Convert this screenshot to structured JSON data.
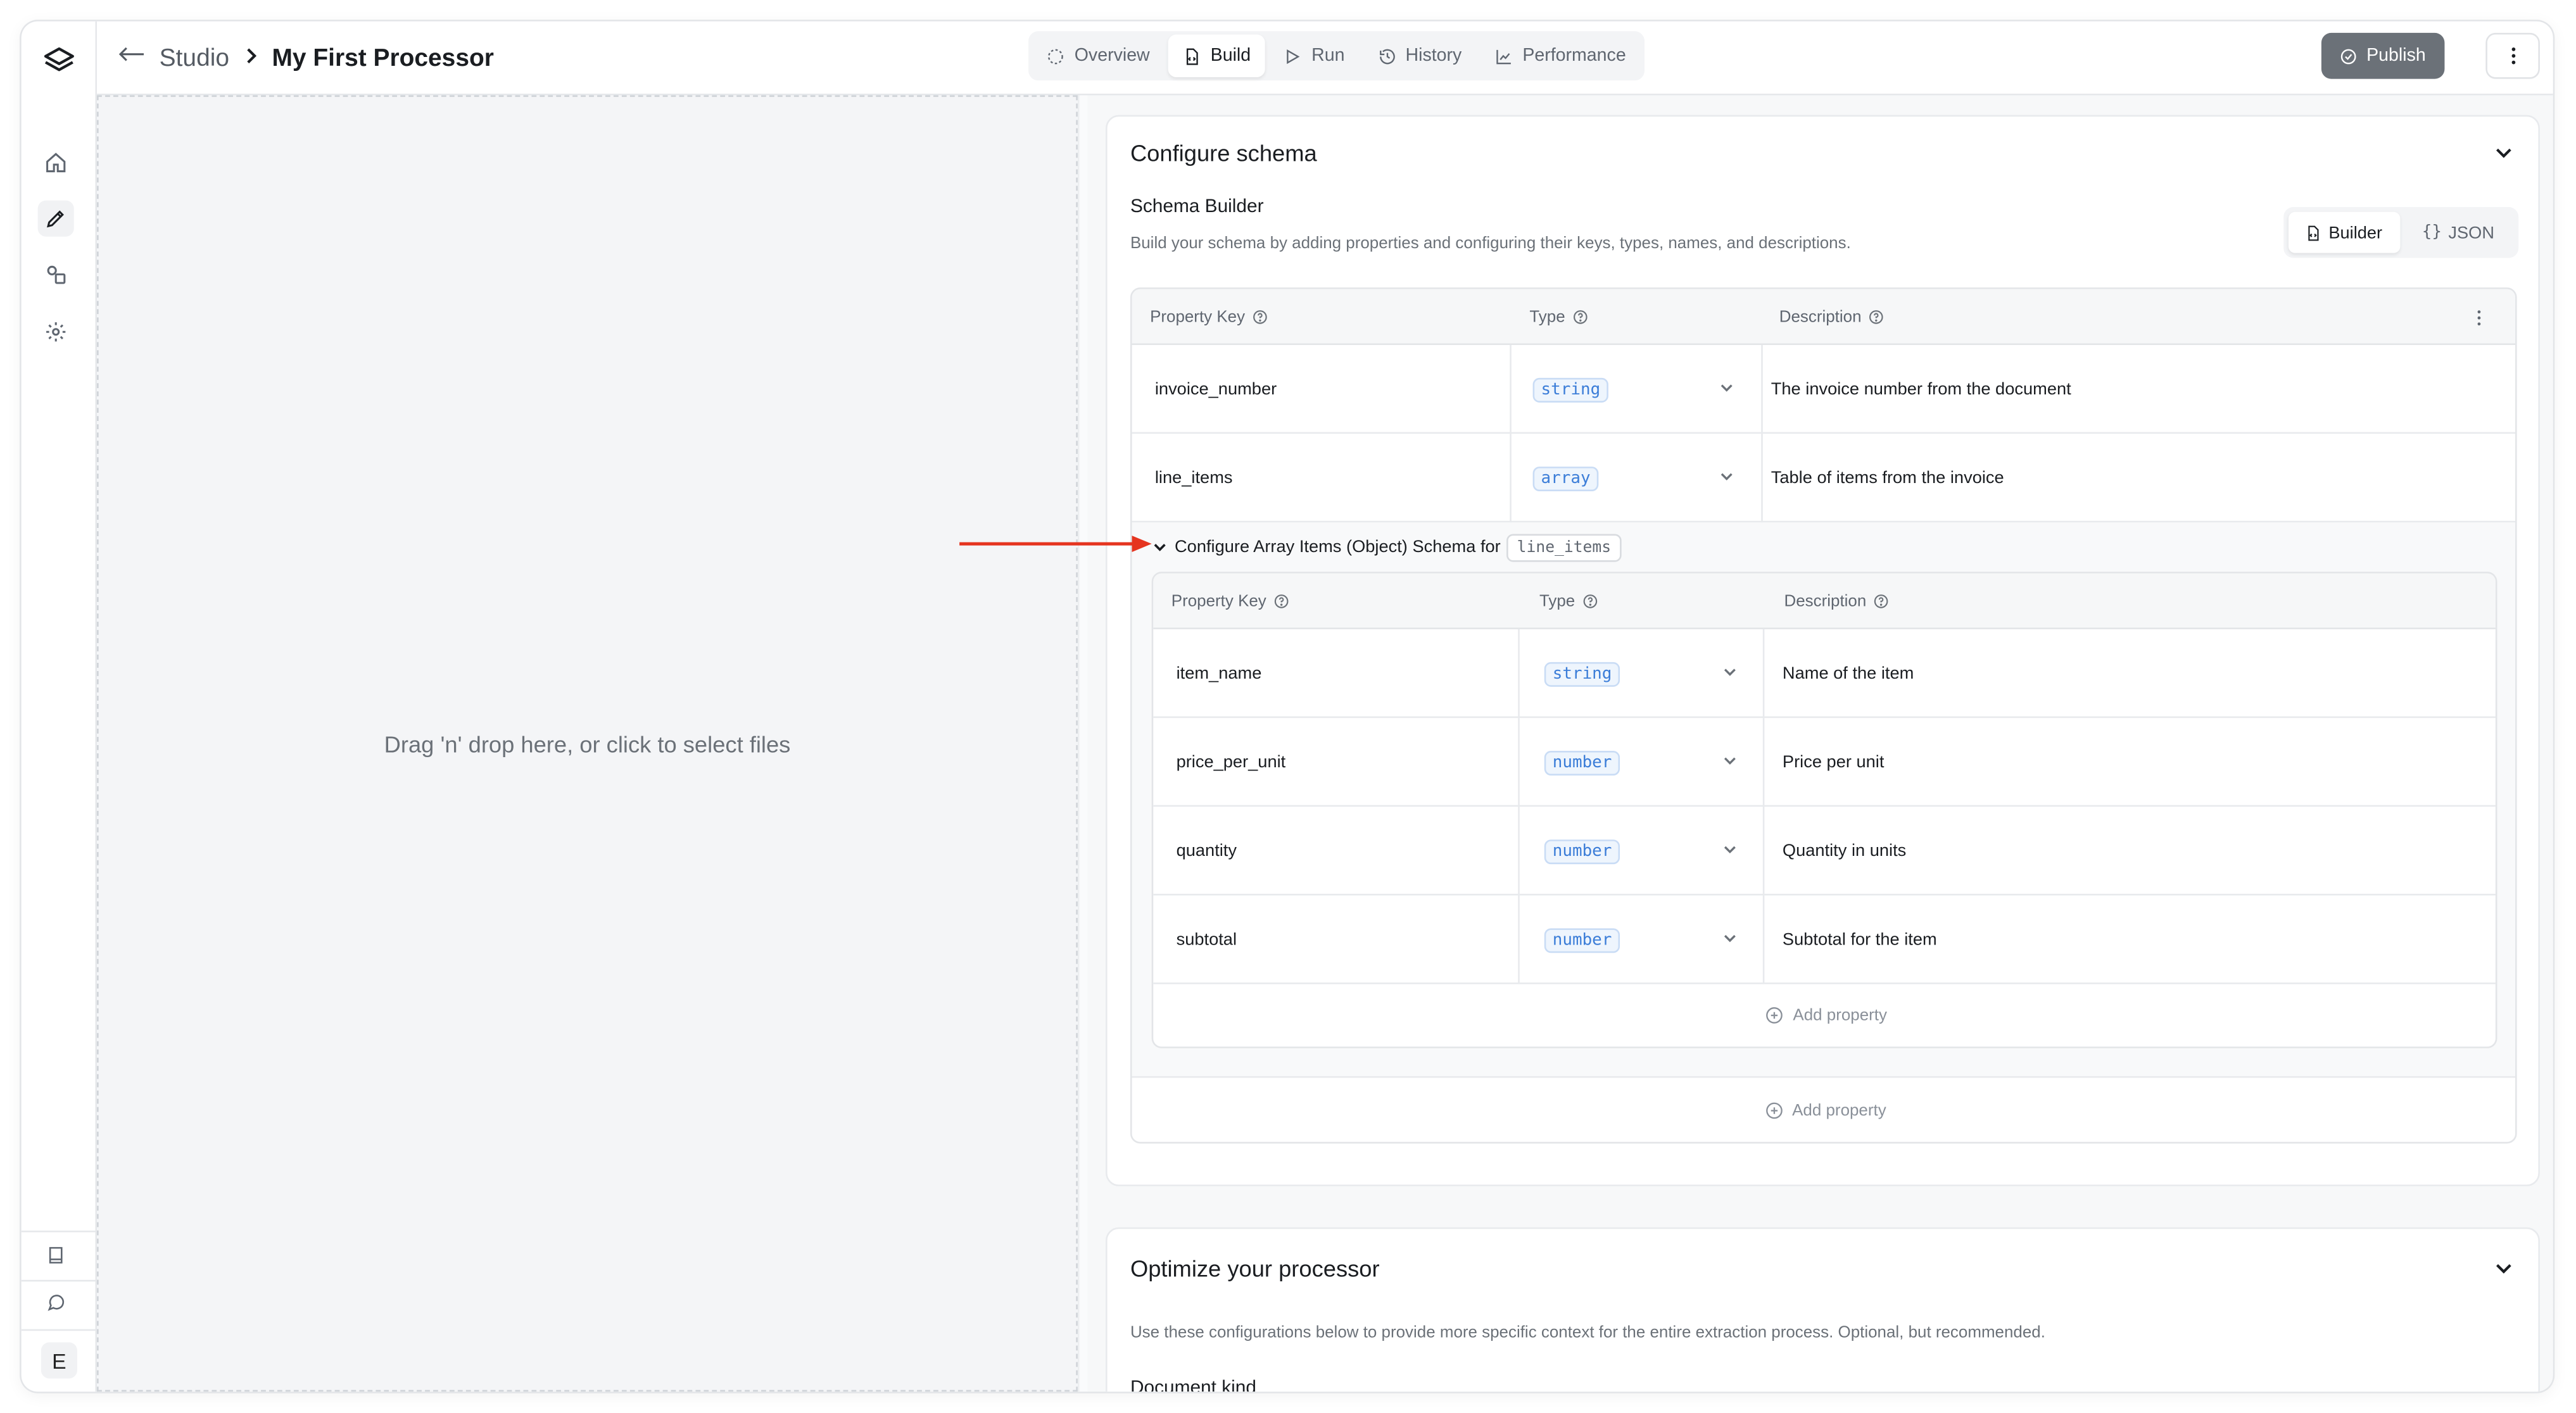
{
  "breadcrumb": {
    "parent": "Studio",
    "current": "My First Processor"
  },
  "tabs": [
    {
      "label": "Overview",
      "icon": "circle-dashed-icon"
    },
    {
      "label": "Build",
      "icon": "file-code-icon",
      "active": true
    },
    {
      "label": "Run",
      "icon": "play-icon"
    },
    {
      "label": "History",
      "icon": "history-icon"
    },
    {
      "label": "Performance",
      "icon": "chart-icon"
    }
  ],
  "publish_label": "Publish",
  "dropzone_text": "Drag 'n' drop here, or click to select files",
  "avatar_letter": "E",
  "schema": {
    "title": "Configure schema",
    "builder_title": "Schema Builder",
    "builder_desc": "Build your schema by adding properties and configuring their keys, types, names, and descriptions.",
    "mode_builder": "Builder",
    "mode_json": "JSON",
    "col_key": "Property Key",
    "col_type": "Type",
    "col_desc": "Description",
    "rows": [
      {
        "key": "invoice_number",
        "type": "string",
        "desc": "The invoice number from the document"
      },
      {
        "key": "line_items",
        "type": "array",
        "desc": "Table of items from the invoice"
      }
    ],
    "array_header": "Configure Array Items (Object) Schema for",
    "array_field": "line_items",
    "nested_rows": [
      {
        "key": "item_name",
        "type": "string",
        "desc": "Name of the item"
      },
      {
        "key": "price_per_unit",
        "type": "number",
        "desc": "Price per unit"
      },
      {
        "key": "quantity",
        "type": "number",
        "desc": "Quantity in units"
      },
      {
        "key": "subtotal",
        "type": "number",
        "desc": "Subtotal for the item"
      }
    ],
    "add_property": "Add property"
  },
  "optimize": {
    "title": "Optimize your processor",
    "desc": "Use these configurations below to provide more specific context for the entire extraction process. Optional, but recommended.",
    "next_label": "Document kind"
  },
  "colors": {
    "accent_type": "#3b7dd8",
    "annotation_arrow": "#e5341f",
    "publish_bg": "#6b7178"
  }
}
